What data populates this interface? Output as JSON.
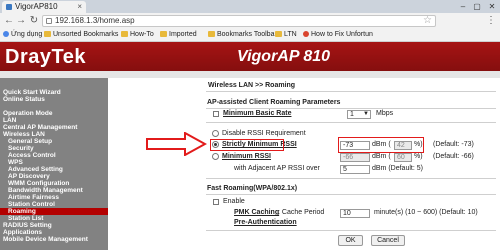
{
  "browser": {
    "tab_title": "VigorAP810",
    "url": "192.168.1.3/home.asp",
    "bookmarks": [
      "Ứng dụng",
      "Unsorted Bookmarks",
      "How-To",
      "Imported",
      "Bookmarks Toolbar",
      "LTN",
      "How to Fix Unfortun"
    ]
  },
  "header": {
    "logo": "DrayTek",
    "model": "VigorAP 810"
  },
  "sidebar": {
    "items": [
      "Quick Start Wizard",
      "Online Status",
      "Operation Mode",
      "LAN",
      "Central AP Management",
      "Wireless LAN",
      "General Setup",
      "Security",
      "Access Control",
      "WPS",
      "Advanced Setting",
      "AP Discovery",
      "WMM Configuration",
      "Bandwidth Management",
      "Airtime Fairness",
      "Station Control",
      "Roaming",
      "Station List",
      "RADIUS Setting",
      "Applications",
      "Mobile Device Management"
    ]
  },
  "main": {
    "breadcrumb": "Wireless LAN >> Roaming",
    "ap_title": "AP-assisted Client Roaming Parameters",
    "min_basic_rate_label": "Minimum Basic Rate",
    "min_basic_rate_value": "1",
    "min_basic_rate_unit": "Mbps",
    "disable_rssi": "Disable RSSI Requirement",
    "strict_min_rssi": "Strictly Minimum RSSI",
    "strict_rssi_value": "-73",
    "strict_percent": "42",
    "dbm": "dBm (",
    "pct_close": "%)",
    "strict_default": "(Default: -73)",
    "min_rssi": "Minimum RSSI",
    "min_rssi_value": "-66",
    "min_percent": "60",
    "min_default": "(Default: -66)",
    "adjacent_label": "with Adjacent AP RSSI over",
    "adjacent_value": "5",
    "adjacent_unit": "dBm (Default: 5)",
    "fast_title": "Fast Roaming(WPA/802.1x)",
    "enable_label": "Enable",
    "pmk_label": "PMK Caching",
    "pmk_suffix": ": Cache Period",
    "pmk_value": "10",
    "pmk_unit": "minute(s) (10 ~ 600) (Default: 10)",
    "preauth": "Pre-Authentication",
    "ok": "OK",
    "cancel": "Cancel"
  }
}
